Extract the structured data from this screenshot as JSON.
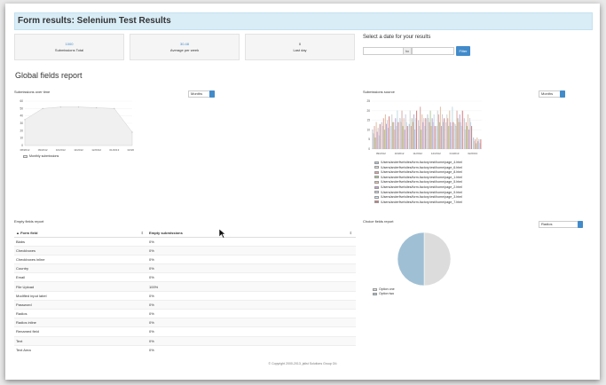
{
  "header": {
    "title": "Form results: Selenium Test Results"
  },
  "stats": [
    {
      "value": "1000",
      "label": "Submissions Total"
    },
    {
      "value": "30.48",
      "label": "Average per week"
    },
    {
      "value": "0",
      "label": "Last day"
    }
  ],
  "date_filter": {
    "label": "Select a date for your results",
    "addon": "to",
    "button": "Filter"
  },
  "global_title": "Global fields report",
  "submissions_over_time": {
    "title": "Submissions over time",
    "select": "Months",
    "legend": "Monthly submissions",
    "y_ticks": [
      "60",
      "50",
      "40",
      "30",
      "20",
      "10",
      "0"
    ],
    "x_ticks": [
      "08/2012",
      "09/2012",
      "10/2012",
      "11/2012",
      "12/2012",
      "01/2013",
      "02/2013"
    ]
  },
  "submissions_source": {
    "title": "Submissions source",
    "select": "Months",
    "y_ticks": [
      "25",
      "20",
      "15",
      "10",
      "5",
      "0"
    ],
    "x_ticks": [
      "09/2012",
      "10/2012",
      "11/2012",
      "12/2012",
      "01/2013",
      "02/2013"
    ],
    "legend": [
      "/Users/anderfive/sites/form-factory.test/home/page_4.html",
      "/Users/anderfive/sites/form-factory.test/home/page_6.html",
      "/Users/anderfive/sites/form-factory.test/home/page_8.html",
      "/Users/anderfive/sites/form-factory.test/home/page_1.html",
      "/Users/anderfive/sites/form-factory.test/home/page_5.html",
      "/Users/anderfive/sites/form-factory.test/home/page_2.html",
      "/Users/anderfive/sites/form-factory.test/home/page_9.html",
      "/Users/anderfive/sites/form-factory.test/home/page_3.html",
      "/Users/anderfive/sites/form-factory.test/home/page_7.html"
    ]
  },
  "empty_fields": {
    "title": "Empty fields report",
    "col_field": "Form field",
    "col_empty": "Empty submissions",
    "rows": [
      [
        "Blabs",
        "0%"
      ],
      [
        "Checkboxes",
        "0%"
      ],
      [
        "Checkboxes inline",
        "0%"
      ],
      [
        "Country",
        "0%"
      ],
      [
        "Email",
        "0%"
      ],
      [
        "File Upload",
        "100%"
      ],
      [
        "Modified input label",
        "0%"
      ],
      [
        "Password",
        "0%"
      ],
      [
        "Radios",
        "0%"
      ],
      [
        "Radios inline",
        "0%"
      ],
      [
        "Renamed field",
        "0%"
      ],
      [
        "Text",
        "0%"
      ],
      [
        "Text Area",
        "0%"
      ]
    ]
  },
  "choice_fields": {
    "title": "Choice fields report",
    "select": "Radios",
    "legend": [
      "Option one",
      "Option two"
    ]
  },
  "footer": "© Copyright 2000-2013, jalist Solutions Group Oü",
  "chart_data": [
    {
      "type": "area",
      "title": "Submissions over time",
      "x": [
        "08/2012",
        "09/2012",
        "10/2012",
        "11/2012",
        "12/2012",
        "01/2013",
        "02/2013"
      ],
      "series": [
        {
          "name": "Monthly submissions",
          "values": [
            35,
            50,
            52,
            52,
            51,
            50,
            18
          ]
        }
      ],
      "ylim": [
        0,
        60
      ]
    },
    {
      "type": "bar",
      "title": "Submissions source",
      "categories": [
        "09/2012",
        "",
        "10/2012",
        "",
        "11/2012",
        "",
        "12/2012",
        "",
        "01/2013",
        "",
        "02/2013",
        ""
      ],
      "series": [
        {
          "name": "/Users/anderfive/sites/form-factory.test/home/page_4.html",
          "values": [
            10,
            14,
            12,
            16,
            13,
            15,
            18,
            12,
            14,
            13,
            16,
            6
          ]
        },
        {
          "name": "/Users/anderfive/sites/form-factory.test/home/page_6.html",
          "values": [
            8,
            12,
            18,
            14,
            20,
            12,
            16,
            20,
            18,
            12,
            10,
            4
          ]
        },
        {
          "name": "/Users/anderfive/sites/form-factory.test/home/page_8.html",
          "values": [
            12,
            16,
            14,
            20,
            12,
            22,
            14,
            18,
            16,
            20,
            14,
            5
          ]
        },
        {
          "name": "/Users/anderfive/sites/form-factory.test/home/page_1.html",
          "values": [
            6,
            10,
            14,
            12,
            16,
            10,
            20,
            14,
            12,
            16,
            12,
            3
          ]
        },
        {
          "name": "/Users/anderfive/sites/form-factory.test/home/page_5.html",
          "values": [
            14,
            18,
            10,
            16,
            14,
            18,
            12,
            22,
            20,
            14,
            18,
            6
          ]
        },
        {
          "name": "/Users/anderfive/sites/form-factory.test/home/page_2.html",
          "values": [
            9,
            13,
            16,
            10,
            18,
            14,
            16,
            12,
            14,
            18,
            10,
            4
          ]
        },
        {
          "name": "/Users/anderfive/sites/form-factory.test/home/page_9.html",
          "values": [
            11,
            15,
            12,
            18,
            10,
            16,
            14,
            18,
            12,
            14,
            16,
            5
          ]
        },
        {
          "name": "/Users/anderfive/sites/form-factory.test/home/page_3.html",
          "values": [
            7,
            11,
            20,
            14,
            16,
            12,
            18,
            14,
            22,
            12,
            14,
            3
          ]
        },
        {
          "name": "/Users/anderfive/sites/form-factory.test/home/page_7.html",
          "values": [
            13,
            17,
            14,
            12,
            20,
            16,
            12,
            16,
            14,
            20,
            12,
            5
          ]
        }
      ],
      "ylim": [
        0,
        25
      ]
    },
    {
      "type": "pie",
      "title": "Choice fields report",
      "categories": [
        "Option one",
        "Option two"
      ],
      "values": [
        50,
        50
      ]
    }
  ],
  "colors": {
    "header_bg": "#d9edf7",
    "accent": "#428bca",
    "pie_one": "#dcdcdc",
    "pie_two": "#9fbfd4"
  }
}
